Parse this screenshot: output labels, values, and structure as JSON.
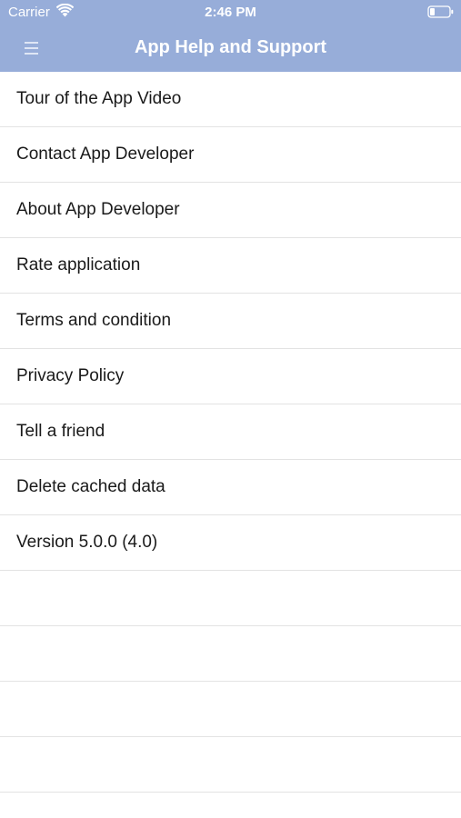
{
  "status_bar": {
    "carrier": "Carrier",
    "time": "2:46 PM",
    "wifi_icon": "wifi-icon",
    "battery_icon": "battery-icon"
  },
  "nav": {
    "title": "App Help and Support",
    "menu_icon": "hamburger-menu-icon",
    "bar_color": "#97add9"
  },
  "menu": {
    "items": [
      {
        "label": "Tour of the App Video"
      },
      {
        "label": "Contact App Developer"
      },
      {
        "label": "About App Developer"
      },
      {
        "label": "Rate application"
      },
      {
        "label": "Terms and condition"
      },
      {
        "label": "Privacy Policy"
      },
      {
        "label": "Tell a friend"
      },
      {
        "label": "Delete cached data"
      },
      {
        "label": "Version 5.0.0 (4.0)"
      }
    ],
    "empty_rows": 4
  }
}
